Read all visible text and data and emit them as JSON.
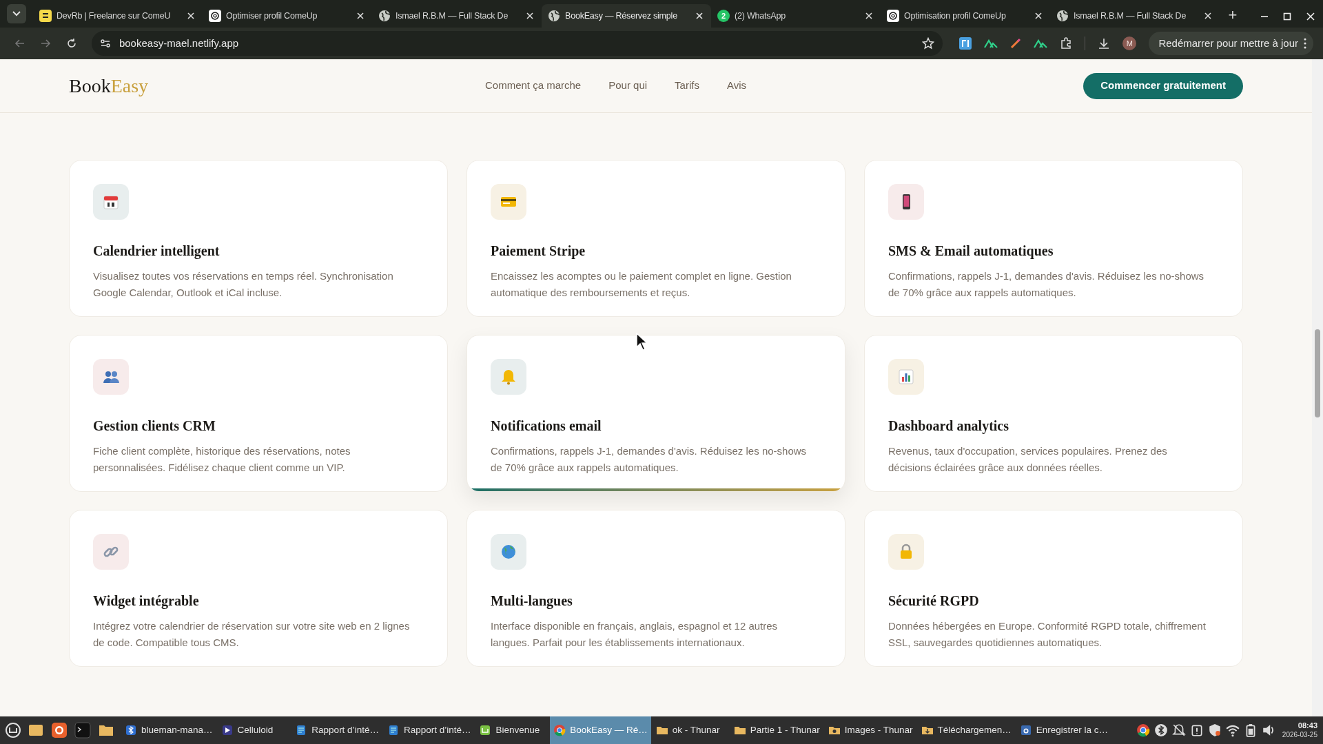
{
  "browser": {
    "tabs": [
      {
        "title": "DevRb | Freelance sur ComeU",
        "kind": "devrb",
        "selected": false
      },
      {
        "title": "Optimiser profil ComeUp",
        "kind": "openai",
        "selected": false
      },
      {
        "title": "Ismael R.B.M — Full Stack De",
        "kind": "globe",
        "selected": false
      },
      {
        "title": "BookEasy — Réservez simple",
        "kind": "globe",
        "selected": true
      },
      {
        "title": "(2) WhatsApp",
        "kind": "whatsapp",
        "badge": "2",
        "selected": false
      },
      {
        "title": "Optimisation profil ComeUp",
        "kind": "openai",
        "selected": false
      },
      {
        "title": "Ismael R.B.M — Full Stack De",
        "kind": "globe",
        "selected": false
      }
    ],
    "new_tab": "+",
    "url": "bookeasy-mael.netlify.app",
    "profile": "M",
    "update_button": "Redémarrer pour mettre à jour"
  },
  "site": {
    "logo": {
      "part_1": "Book",
      "part_2": "Easy"
    },
    "nav": [
      "Comment ça marche",
      "Pour qui",
      "Tarifs",
      "Avis"
    ],
    "cta": "Commencer gratuitement",
    "features": [
      {
        "kind": "calendar",
        "color": "#e8eeee",
        "title": "Calendrier intelligent",
        "text": "Visualisez toutes vos réservations en temps réel. Synchronisation Google Calendar, Outlook et iCal incluse.",
        "highlighted": false
      },
      {
        "kind": "card",
        "color": "#f7f1e4",
        "title": "Paiement Stripe",
        "text": "Encaissez les acomptes ou le paiement complet en ligne. Gestion automatique des remboursements et reçus.",
        "highlighted": false
      },
      {
        "kind": "phone",
        "color": "#f7ebeb",
        "title": "SMS & Email automatiques",
        "text": "Confirmations, rappels J-1, demandes d'avis. Réduisez les no-shows de 70% grâce aux rappels automatiques.",
        "highlighted": false
      },
      {
        "kind": "people",
        "color": "#f7ebeb",
        "title": "Gestion clients CRM",
        "text": "Fiche client complète, historique des réservations, notes personnalisées. Fidélisez chaque client comme un VIP.",
        "highlighted": false
      },
      {
        "kind": "bell",
        "color": "#e8eeee",
        "title": "Notifications email",
        "text": "Confirmations, rappels J-1, demandes d'avis. Réduisez les no-shows de 70% grâce aux rappels automatiques.",
        "highlighted": true
      },
      {
        "kind": "chart",
        "color": "#f7f1e4",
        "title": "Dashboard analytics",
        "text": "Revenus, taux d'occupation, services populaires. Prenez des décisions éclairées grâce aux données réelles.",
        "highlighted": false
      },
      {
        "kind": "link",
        "color": "#f7ebeb",
        "title": "Widget intégrable",
        "text": "Intégrez votre calendrier de réservation sur votre site web en 2 lignes de code. Compatible tous CMS.",
        "highlighted": false
      },
      {
        "kind": "globe",
        "color": "#e8eeee",
        "title": "Multi-langues",
        "text": "Interface disponible en français, anglais, espagnol et 12 autres langues. Parfait pour les établissements internationaux.",
        "highlighted": false
      },
      {
        "kind": "lock",
        "color": "#f7f1e4",
        "title": "Sécurité RGPD",
        "text": "Données hébergées en Europe. Conformité RGPD totale, chiffrement SSL, sauvegardes quotidiennes automatiques.",
        "highlighted": false
      }
    ]
  },
  "taskbar": {
    "windows": [
      {
        "title": "blueman-mana…",
        "kind": "bluetooth",
        "selected": false
      },
      {
        "title": "Celluloid",
        "kind": "play",
        "selected": false
      },
      {
        "title": "Rapport d’inté…",
        "kind": "doc",
        "selected": false
      },
      {
        "title": "Rapport d’inté…",
        "kind": "doc",
        "selected": false
      },
      {
        "title": "Bienvenue",
        "kind": "mint",
        "selected": false
      },
      {
        "title": "BookEasy — Ré…",
        "kind": "chrome",
        "selected": true
      },
      {
        "title": "ok - Thunar",
        "kind": "folder",
        "selected": false
      },
      {
        "title": "Partie 1 - Thunar",
        "kind": "folder",
        "selected": false
      },
      {
        "title": "Images - Thunar",
        "kind": "camera",
        "selected": false
      },
      {
        "title": "Téléchargemen…",
        "kind": "download",
        "selected": false
      },
      {
        "title": "Enregistrer la c…",
        "kind": "screenshot",
        "selected": false
      }
    ],
    "time": "08:43",
    "date": "2026-03-25"
  }
}
